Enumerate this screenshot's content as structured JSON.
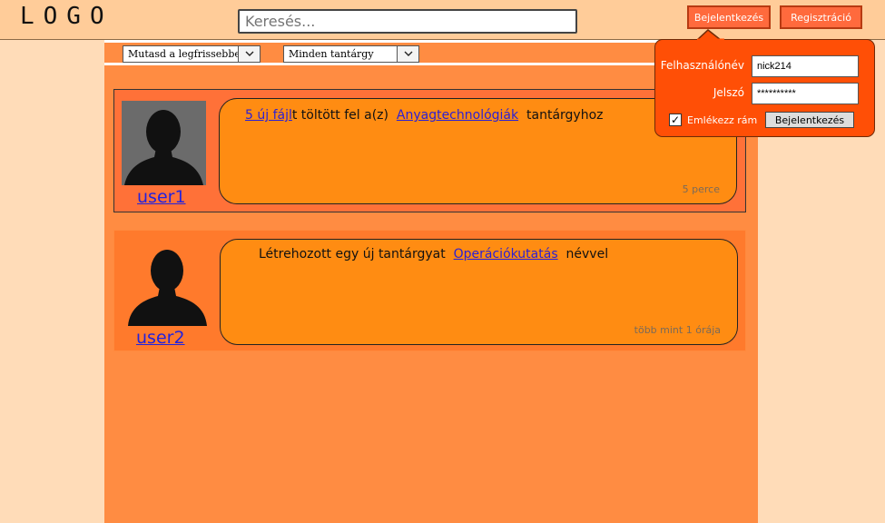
{
  "header": {
    "logo": "LOGO",
    "search_placeholder": "Keresés...",
    "login_label": "Bejelentkezés",
    "register_label": "Regisztráció"
  },
  "filters": {
    "sort_selected": "Mutasd a legfrissebbet",
    "subject_selected": "Minden tantárgy"
  },
  "feed": [
    {
      "username": "user1",
      "link1": "5 új fájl",
      "text1": "t töltött fel a(z)",
      "link2": "Anyagtechnológiák",
      "text2": "tantárgyhoz",
      "time": "5 perce"
    },
    {
      "username": "user2",
      "text1": "Létrehozott egy új tantárgyat",
      "link1": "Operációkutatás",
      "text2": "névvel",
      "time": "több mint 1 órája"
    }
  ],
  "login_popup": {
    "username_label": "Felhasználónév",
    "username_value": "nick214",
    "password_label": "Jelszó",
    "password_value": "**********",
    "remember_label": "Emlékezz rám",
    "remember_checked": "✓",
    "submit_label": "Bejelentkezés"
  },
  "colors": {
    "header_bg": "#ffcc99",
    "page_bg": "#ffdcb8",
    "main_bg": "#ff8c42",
    "accent": "#ff6a3d",
    "popup_bg": "#ff4f06",
    "bubble_bg": "#ff8c12",
    "link": "#2a1fd6"
  }
}
